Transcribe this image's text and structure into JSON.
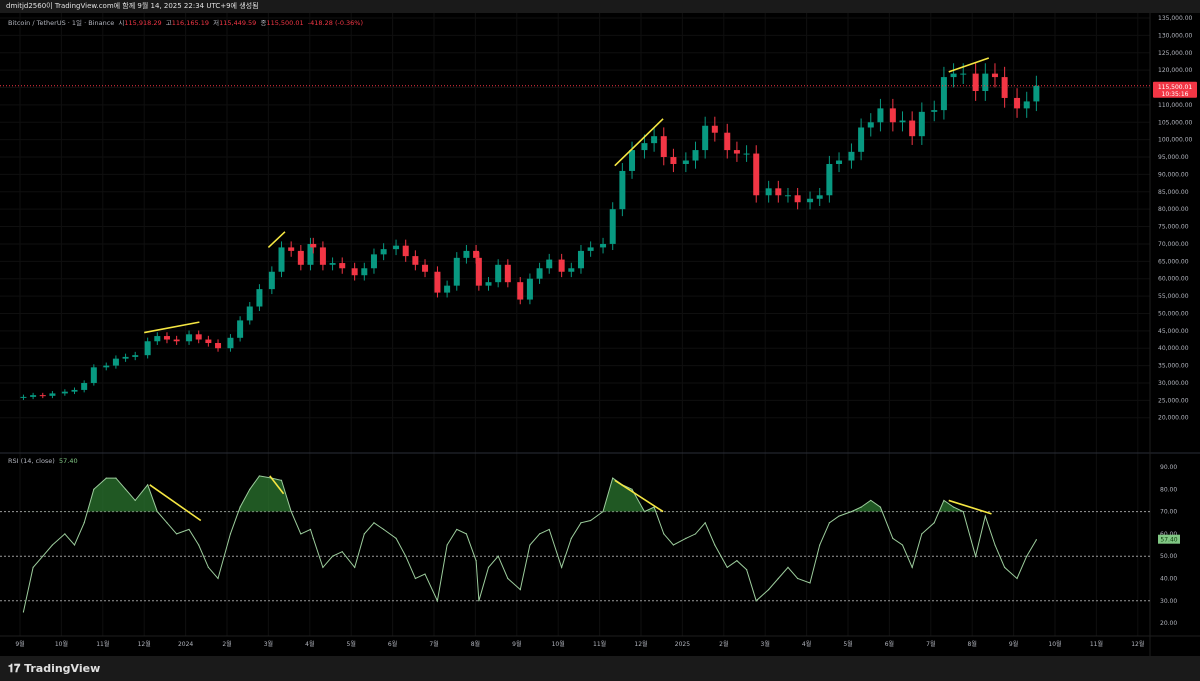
{
  "topbar": {
    "caption": "dmitjd2560이 TradingView.com에 함께 9월 14, 2025 22:34 UTC+9에 생성됨"
  },
  "legend": {
    "symbol": "Bitcoin / TetherUS · 1일 · Binance",
    "open_label": "시",
    "open": "115,918.29",
    "high_label": "고",
    "high": "116,165.19",
    "low_label": "저",
    "low": "115,449.59",
    "close_label": "종",
    "close": "115,500.01",
    "change": "-418.28 (-0.36%)"
  },
  "price_badge": {
    "price": "115,500.01",
    "countdown": "10:35:16"
  },
  "rsi_legend": {
    "name": "RSI (14, close)",
    "value": "57.40"
  },
  "brand": {
    "logo_text": "TradingView"
  },
  "colors": {
    "up": "#089981",
    "down": "#f23645",
    "rsi": "#9ccc9c",
    "trendline": "#f5e642",
    "rsi_fill": "#2e7d32"
  },
  "chart_data": [
    {
      "type": "candlestick",
      "title": "Bitcoin / TetherUS · 1일 · Binance",
      "ylim": [
        17500,
        137500
      ],
      "y_ticks": [
        "135,000.00",
        "130,000.00",
        "125,000.00",
        "120,000.00",
        "115,000.00",
        "110,000.00",
        "105,000.00",
        "100,000.00",
        "95,000.00",
        "90,000.00",
        "85,000.00",
        "80,000.00",
        "75,000.00",
        "70,000.00",
        "65,000.00",
        "60,000.00",
        "55,000.00",
        "50,000.00",
        "45,000.00",
        "40,000.00",
        "35,000.00",
        "30,000.00",
        "25,000.00",
        "20,000.00"
      ],
      "x_ticks": [
        "9월",
        "10월",
        "11월",
        "12월",
        "2024",
        "2월",
        "3월",
        "4월",
        "5월",
        "6월",
        "7월",
        "8월",
        "9월",
        "10월",
        "11월",
        "12월",
        "2025",
        "2월",
        "3월",
        "4월",
        "5월",
        "6월",
        "7월",
        "8월",
        "9월",
        "10월",
        "11월",
        "12월"
      ],
      "grid": true,
      "months": [
        {
          "m": "2023-09",
          "closes": [
            26000,
            26500,
            26300,
            27000
          ],
          "rsi": [
            25,
            45,
            50,
            55
          ]
        },
        {
          "m": "2023-10",
          "closes": [
            27500,
            28000,
            30000,
            34500
          ],
          "rsi": [
            60,
            55,
            65,
            80
          ]
        },
        {
          "m": "2023-11",
          "closes": [
            35000,
            37000,
            37500,
            38000
          ],
          "rsi": [
            85,
            85,
            80,
            75
          ]
        },
        {
          "m": "2023-12",
          "closes": [
            42000,
            43500,
            42500,
            42000
          ],
          "rsi": [
            82,
            70,
            65,
            60
          ]
        },
        {
          "m": "2024-01",
          "closes": [
            44000,
            42500,
            41500,
            40000
          ],
          "rsi": [
            62,
            55,
            45,
            40
          ]
        },
        {
          "m": "2024-02",
          "closes": [
            43000,
            48000,
            52000,
            57000
          ],
          "rsi": [
            60,
            72,
            80,
            86
          ]
        },
        {
          "m": "2024-03",
          "closes": [
            62000,
            69000,
            68000,
            64000,
            70000
          ],
          "rsi": [
            85,
            84,
            70,
            60,
            62
          ]
        },
        {
          "m": "2024-04",
          "closes": [
            69000,
            64000,
            64500,
            63000
          ],
          "rsi": [
            58,
            45,
            50,
            52
          ]
        },
        {
          "m": "2024-05",
          "closes": [
            61000,
            63000,
            67000,
            68500
          ],
          "rsi": [
            45,
            60,
            65,
            62
          ]
        },
        {
          "m": "2024-06",
          "closes": [
            69500,
            66500,
            64000,
            62000
          ],
          "rsi": [
            58,
            50,
            40,
            42
          ]
        },
        {
          "m": "2024-07",
          "closes": [
            56000,
            58000,
            66000,
            68000,
            66000
          ],
          "rsi": [
            30,
            55,
            62,
            60,
            48
          ]
        },
        {
          "m": "2024-08",
          "closes": [
            58000,
            59000,
            64000,
            59000
          ],
          "rsi": [
            30,
            45,
            50,
            40
          ]
        },
        {
          "m": "2024-09",
          "closes": [
            54000,
            60000,
            63000,
            65500
          ],
          "rsi": [
            35,
            55,
            60,
            62
          ]
        },
        {
          "m": "2024-10",
          "closes": [
            62000,
            63000,
            68000,
            69000
          ],
          "rsi": [
            45,
            58,
            65,
            66
          ]
        },
        {
          "m": "2024-11",
          "closes": [
            70000,
            80000,
            91000,
            97000
          ],
          "rsi": [
            70,
            85,
            82,
            80
          ]
        },
        {
          "m": "2024-12",
          "closes": [
            99000,
            101000,
            95000,
            93000
          ],
          "rsi": [
            70,
            72,
            60,
            55
          ]
        },
        {
          "m": "2025-01",
          "closes": [
            94000,
            97000,
            104000,
            102000
          ],
          "rsi": [
            58,
            60,
            65,
            55
          ]
        },
        {
          "m": "2025-02",
          "closes": [
            97000,
            96000,
            96000,
            84000
          ],
          "rsi": [
            45,
            48,
            44,
            30
          ]
        },
        {
          "m": "2025-03",
          "closes": [
            86000,
            84000,
            84000,
            82000
          ],
          "rsi": [
            35,
            40,
            45,
            40
          ]
        },
        {
          "m": "2025-04",
          "closes": [
            83000,
            84000,
            93000,
            94000
          ],
          "rsi": [
            38,
            55,
            65,
            68
          ]
        },
        {
          "m": "2025-05",
          "closes": [
            96500,
            103500,
            105000,
            109000
          ],
          "rsi": [
            70,
            72,
            75,
            72
          ]
        },
        {
          "m": "2025-06",
          "closes": [
            105000,
            105500,
            101000,
            108000
          ],
          "rsi": [
            58,
            55,
            45,
            60
          ]
        },
        {
          "m": "2025-07",
          "closes": [
            108500,
            118000,
            119000,
            119000
          ],
          "rsi": [
            65,
            75,
            72,
            70
          ]
        },
        {
          "m": "2025-08",
          "closes": [
            114000,
            119000,
            118000,
            112000
          ],
          "rsi": [
            50,
            68,
            55,
            45
          ]
        },
        {
          "m": "2025-09",
          "closes": [
            109000,
            111000,
            115500
          ],
          "rsi": [
            40,
            50,
            57.4
          ]
        }
      ],
      "last_price": 115500.01,
      "trendlines": [
        {
          "from": {
            "date": "2023-12-01",
            "value": 44500
          },
          "to": {
            "date": "2024-01-11",
            "value": 47500
          }
        },
        {
          "from": {
            "date": "2024-03-01",
            "value": 69000
          },
          "to": {
            "date": "2024-03-13",
            "value": 73500
          }
        },
        {
          "from": {
            "date": "2024-11-12",
            "value": 92500
          },
          "to": {
            "date": "2024-12-17",
            "value": 106000
          }
        },
        {
          "from": {
            "date": "2025-07-14",
            "value": 119500
          },
          "to": {
            "date": "2025-08-13",
            "value": 123500
          }
        }
      ]
    },
    {
      "type": "line",
      "title": "RSI (14, close)",
      "ylim": [
        15,
        95
      ],
      "y_ticks": [
        "90.00",
        "80.00",
        "70.00",
        "60.00",
        "50.00",
        "40.00",
        "30.00",
        "20.00"
      ],
      "bands": [
        70,
        50,
        30
      ],
      "last_value": 57.4,
      "trendlines": [
        {
          "from": {
            "date": "2023-12-05",
            "value": 82
          },
          "to": {
            "date": "2024-01-12",
            "value": 66
          }
        },
        {
          "from": {
            "date": "2024-03-02",
            "value": 86
          },
          "to": {
            "date": "2024-03-12",
            "value": 78
          }
        },
        {
          "from": {
            "date": "2024-11-12",
            "value": 84
          },
          "to": {
            "date": "2024-12-17",
            "value": 70
          }
        },
        {
          "from": {
            "date": "2025-07-14",
            "value": 75
          },
          "to": {
            "date": "2025-08-15",
            "value": 69
          }
        }
      ]
    }
  ]
}
